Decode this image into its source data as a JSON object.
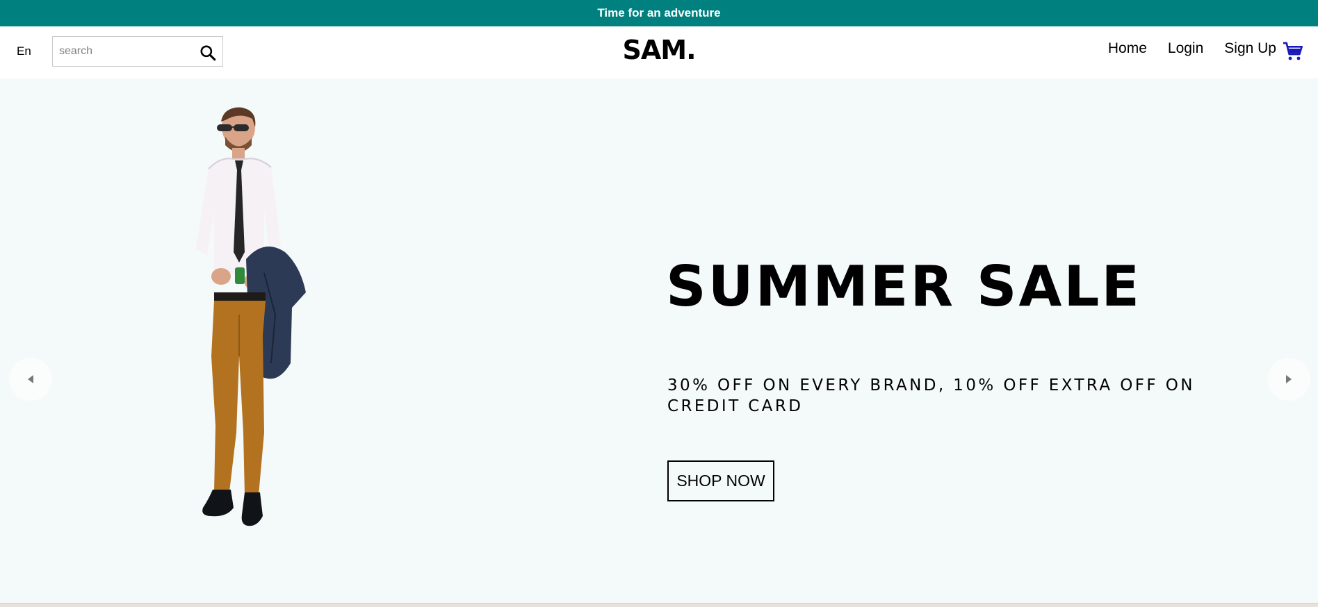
{
  "announcement": {
    "text": "Time for an adventure"
  },
  "navbar": {
    "language": "En",
    "search": {
      "placeholder": "search",
      "value": ""
    },
    "logo": "SAM.",
    "links": [
      "Home",
      "Login",
      "Sign Up"
    ]
  },
  "hero": {
    "title": "SUMMER SALE",
    "description": "30% OFF ON EVERY BRAND, 10% OFF EXTRA OFF ON CREDIT CARD",
    "button_label": "SHOP NOW"
  },
  "icons": {
    "search": "search-icon",
    "cart": "cart-icon",
    "prev": "arrow-left-icon",
    "next": "arrow-right-icon"
  },
  "colors": {
    "announcement_bg": "#00807f",
    "hero_bg": "#f4f9fa",
    "cart_icon": "#1a1ab8"
  }
}
